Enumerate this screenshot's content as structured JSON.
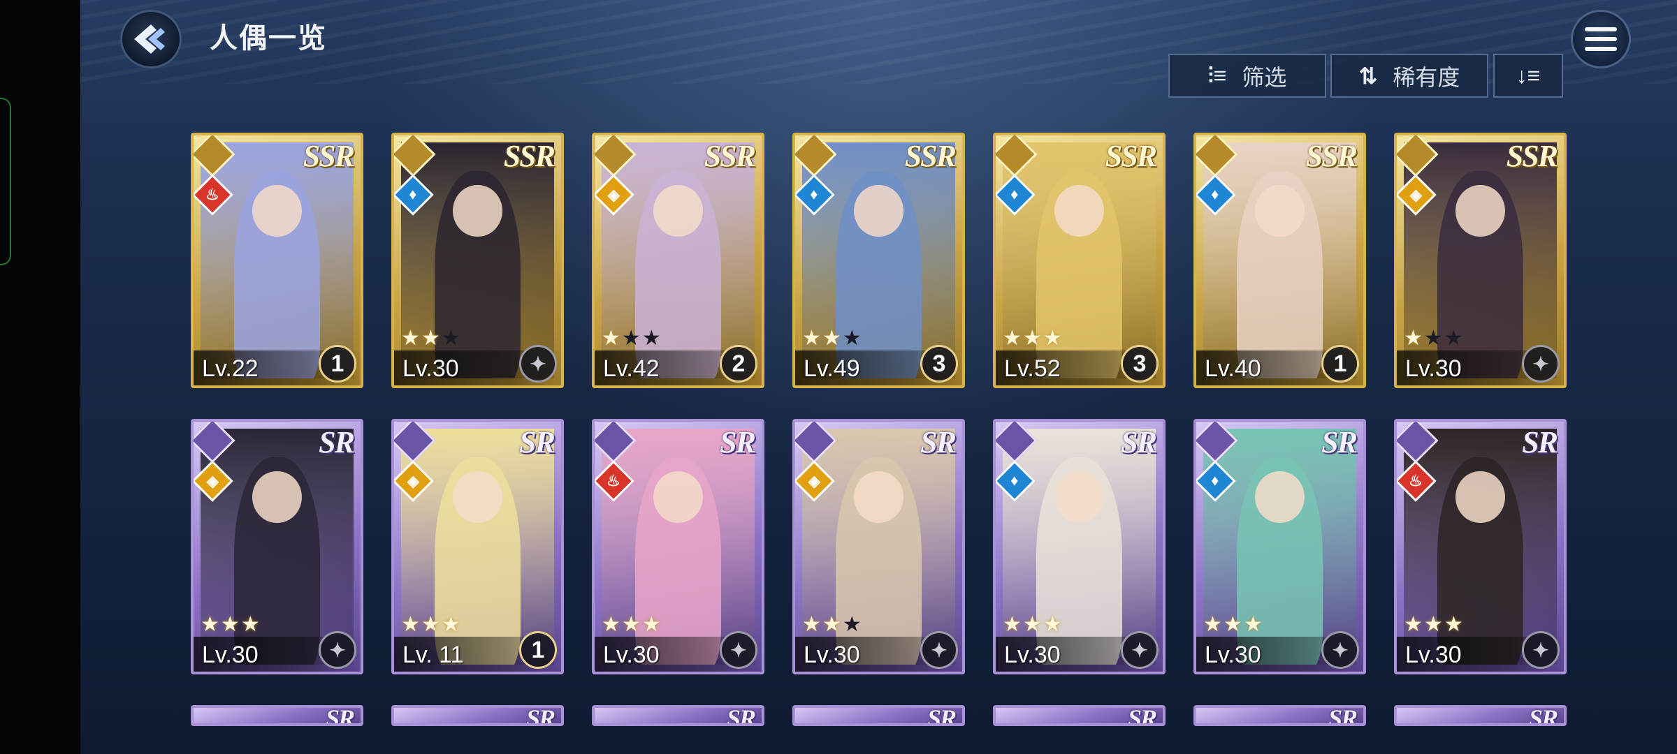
{
  "header": {
    "title": "人偶一览"
  },
  "toolbar": {
    "filter_label": "筛选",
    "rarity_label": "稀有度",
    "filter_icon": "filter-icon",
    "sort_icon": "sort-arrows-icon",
    "order_icon": "sort-order-icon"
  },
  "colors": {
    "ssr_frame": "#d8b24c",
    "sr_frame": "#a891d6",
    "fire": "#d8342a",
    "water": "#1f86d6",
    "light": "#e0a010"
  },
  "cards": [
    {
      "rarity": "SSR",
      "level": "Lv.22",
      "stars": 0,
      "badge": "1",
      "element": "fire",
      "art": "#9aa3e0"
    },
    {
      "rarity": "SSR",
      "level": "Lv.30",
      "stars": 2,
      "badge": "",
      "element": "water",
      "art": "#2a2430"
    },
    {
      "rarity": "SSR",
      "level": "Lv.42",
      "stars": 1,
      "badge": "2",
      "element": "light",
      "art": "#c9b3d6"
    },
    {
      "rarity": "SSR",
      "level": "Lv.49",
      "stars": 2,
      "badge": "3",
      "element": "water",
      "art": "#6f8fc8"
    },
    {
      "rarity": "SSR",
      "level": "Lv.52",
      "stars": 3,
      "badge": "3",
      "element": "water",
      "art": "#e3c46a"
    },
    {
      "rarity": "SSR",
      "level": "Lv.40",
      "stars": 0,
      "badge": "1",
      "element": "water",
      "art": "#e8d2c4"
    },
    {
      "rarity": "SSR",
      "level": "Lv.30",
      "stars": 1,
      "badge": "",
      "element": "light",
      "art": "#3a2b3e"
    },
    {
      "rarity": "SR",
      "level": "Lv.30",
      "stars": 3,
      "badge": "",
      "element": "light",
      "art": "#2a2636"
    },
    {
      "rarity": "SR",
      "level": "Lv. 11",
      "stars": 3,
      "badge": "1",
      "element": "light",
      "art": "#efdf9c"
    },
    {
      "rarity": "SR",
      "level": "Lv.30",
      "stars": 3,
      "badge": "",
      "element": "fire",
      "art": "#e7a6c8"
    },
    {
      "rarity": "SR",
      "level": "Lv.30",
      "stars": 2,
      "badge": "",
      "element": "light",
      "art": "#d9c7ad"
    },
    {
      "rarity": "SR",
      "level": "Lv.30",
      "stars": 3,
      "badge": "",
      "element": "water",
      "art": "#e9e3d8"
    },
    {
      "rarity": "SR",
      "level": "Lv.30",
      "stars": 3,
      "badge": "",
      "element": "water",
      "art": "#78c4b4"
    },
    {
      "rarity": "SR",
      "level": "Lv.30",
      "stars": 3,
      "badge": "",
      "element": "fire",
      "art": "#2c2424"
    }
  ],
  "peek_cards": [
    {
      "rarity": "SR"
    },
    {
      "rarity": "SR"
    },
    {
      "rarity": "SR"
    },
    {
      "rarity": "SR"
    },
    {
      "rarity": "SR"
    },
    {
      "rarity": "SR"
    },
    {
      "rarity": "SR"
    }
  ]
}
